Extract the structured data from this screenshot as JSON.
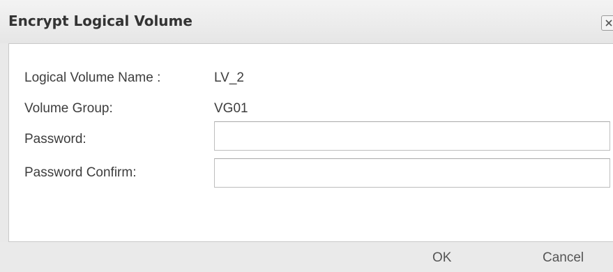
{
  "dialog": {
    "title": "Encrypt Logical Volume",
    "close_icon": "close-icon"
  },
  "form": {
    "lv_name_label": "Logical Volume Name :",
    "lv_name_value": "LV_2",
    "volume_group_label": "Volume Group:",
    "volume_group_value": "VG01",
    "password_label": "Password:",
    "password_value": "",
    "password_confirm_label": "Password Confirm:",
    "password_confirm_value": ""
  },
  "buttons": {
    "ok_label": "OK",
    "cancel_label": "Cancel"
  }
}
